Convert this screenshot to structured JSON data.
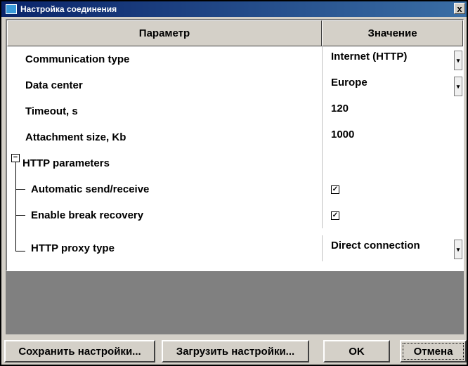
{
  "window": {
    "title": "Настройка соединения",
    "close_glyph": "x"
  },
  "grid": {
    "headers": {
      "param": "Параметр",
      "value": "Значение"
    },
    "rows": [
      {
        "name": "Communication type",
        "value": "Internet (HTTP)",
        "dropdown": true
      },
      {
        "name": "Data center",
        "value": "Europe",
        "dropdown": true
      },
      {
        "name": "Timeout, s",
        "value": "120"
      },
      {
        "name": "Attachment size, Kb",
        "value": "1000"
      },
      {
        "name": "HTTP parameters",
        "group": true,
        "expanded": true
      },
      {
        "name": "Automatic send/receive",
        "checked": true
      },
      {
        "name": "Enable break recovery",
        "checked": true
      },
      {
        "name": "HTTP proxy type",
        "value": "Direct connection",
        "dropdown": true
      }
    ],
    "toggle_glyph": "−",
    "check_glyph": "✓",
    "dropdown_glyph": "▾"
  },
  "buttons": {
    "save": "Сохранить настройки...",
    "load": "Загрузить настройки...",
    "ok": "OK",
    "cancel": "Отмена"
  },
  "colors": {
    "titlebar_start": "#0a246a",
    "titlebar_end": "#3a6ea5",
    "face": "#d4d0c8",
    "empty_area": "#808080"
  }
}
